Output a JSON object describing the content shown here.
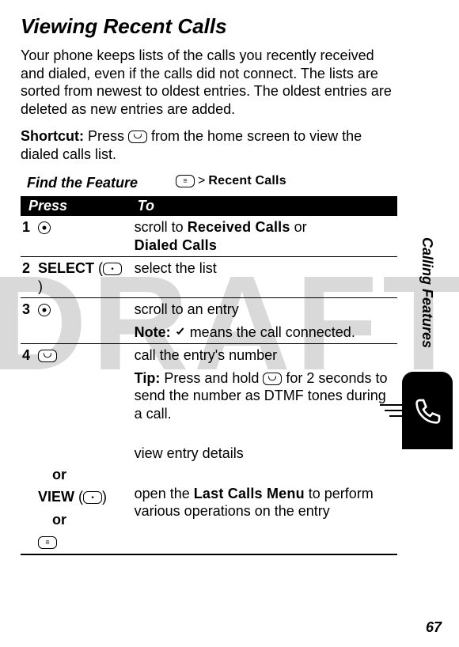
{
  "watermark": "DRAFT",
  "title": "Viewing Recent Calls",
  "intro": "Your phone keeps lists of the calls you recently received and dialed, even if the calls did not connect. The lists are sorted from newest to oldest entries. The oldest entries are deleted as new entries are added.",
  "shortcut": {
    "label": "Shortcut:",
    "before": " Press ",
    "after": " from the home screen to view the dialed calls list."
  },
  "find": {
    "label": "Find the Feature",
    "path_sep": " > ",
    "path_item": "Recent Calls"
  },
  "table": {
    "headers": {
      "press": "Press",
      "to": "To"
    },
    "rows": {
      "r1": {
        "num": "1",
        "to_a": "scroll to ",
        "to_b": "Received Calls",
        "to_c": " or",
        "to_d": "Dialed Calls"
      },
      "r2": {
        "num": "2",
        "press_label": "SELECT",
        "to": "select the list"
      },
      "r3": {
        "num": "3",
        "to": "scroll to an entry",
        "note_label": "Note:",
        "note_text": " means the call connected."
      },
      "r4": {
        "num": "4",
        "to": "call the entry's number",
        "tip_label": "Tip:",
        "tip_a": " Press and hold ",
        "tip_b": " for 2 seconds to send the number as DTMF tones during a call.",
        "or": "or",
        "view_label": "VIEW",
        "view_to": "view entry details",
        "menu_to_a": "open the ",
        "menu_to_b": "Last Calls Menu",
        "menu_to_c": " to perform various operations on the entry"
      }
    }
  },
  "side_label": "Calling Features",
  "page_number": "67"
}
